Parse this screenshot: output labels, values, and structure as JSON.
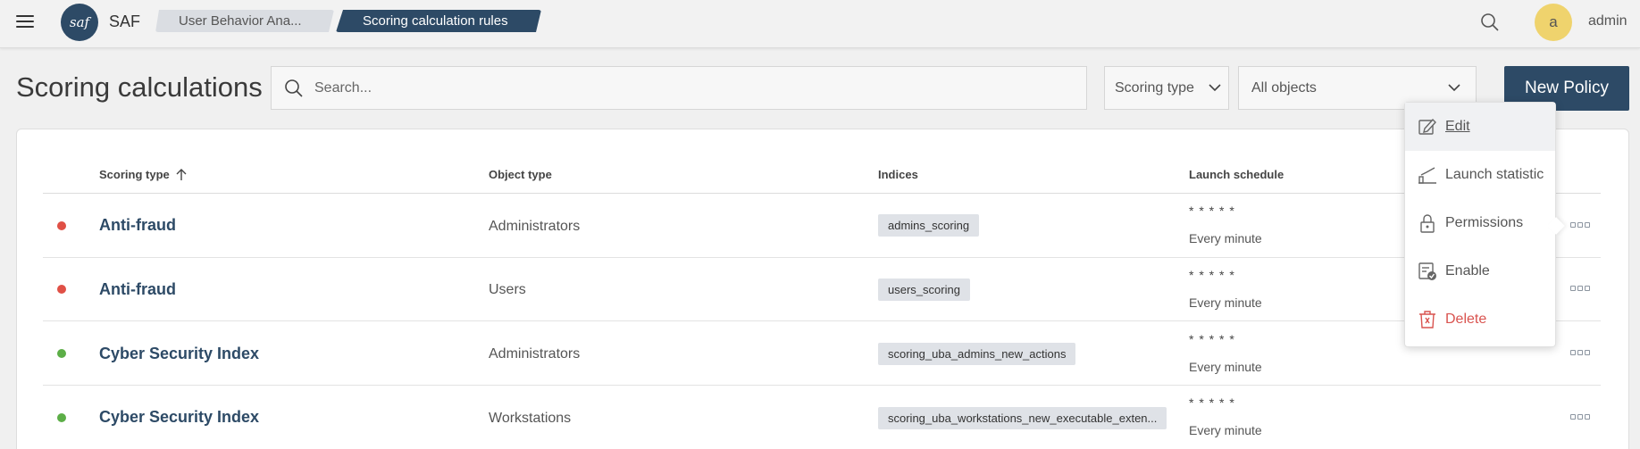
{
  "header": {
    "logo_text": "saf",
    "brand": "SAF",
    "breadcrumbs": [
      "User Behavior Ana...",
      "Scoring calculation rules"
    ],
    "user_initial": "a",
    "username": "admin"
  },
  "toolbar": {
    "title": "Scoring calculations",
    "search_placeholder": "Search...",
    "scoring_type_filter": "Scoring type",
    "objects_filter": "All objects",
    "new_button": "New Policy"
  },
  "table": {
    "columns": [
      "Scoring type",
      "Object type",
      "Indices",
      "Launch schedule"
    ],
    "sort_column": "Scoring type",
    "sort_direction": "ascending",
    "rows": [
      {
        "status": "red",
        "scoring_type": "Anti-fraud",
        "object_type": "Administrators",
        "index": "admins_scoring",
        "cron": "* * * * *",
        "schedule": "Every minute"
      },
      {
        "status": "red",
        "scoring_type": "Anti-fraud",
        "object_type": "Users",
        "index": "users_scoring",
        "cron": "* * * * *",
        "schedule": "Every minute"
      },
      {
        "status": "green",
        "scoring_type": "Cyber Security Index",
        "object_type": "Administrators",
        "index": "scoring_uba_admins_new_actions",
        "cron": "* * * * *",
        "schedule": "Every minute"
      },
      {
        "status": "green",
        "scoring_type": "Cyber Security Index",
        "object_type": "Workstations",
        "index": "scoring_uba_workstations_new_executable_exten...",
        "cron": "* * * * *",
        "schedule": "Every minute"
      }
    ]
  },
  "context_menu": {
    "items": [
      {
        "label": "Edit",
        "icon": "edit-icon",
        "active": true
      },
      {
        "label": "Launch statistic",
        "icon": "statistic-icon"
      },
      {
        "label": "Permissions",
        "icon": "lock-icon"
      },
      {
        "label": "Enable",
        "icon": "enable-icon"
      },
      {
        "label": "Delete",
        "icon": "trash-icon",
        "danger": true
      }
    ]
  },
  "colors": {
    "primary": "#2d4a66",
    "status_red": "#e05046",
    "status_green": "#5cae47",
    "danger": "#d9534f",
    "avatar": "#efd36d"
  }
}
